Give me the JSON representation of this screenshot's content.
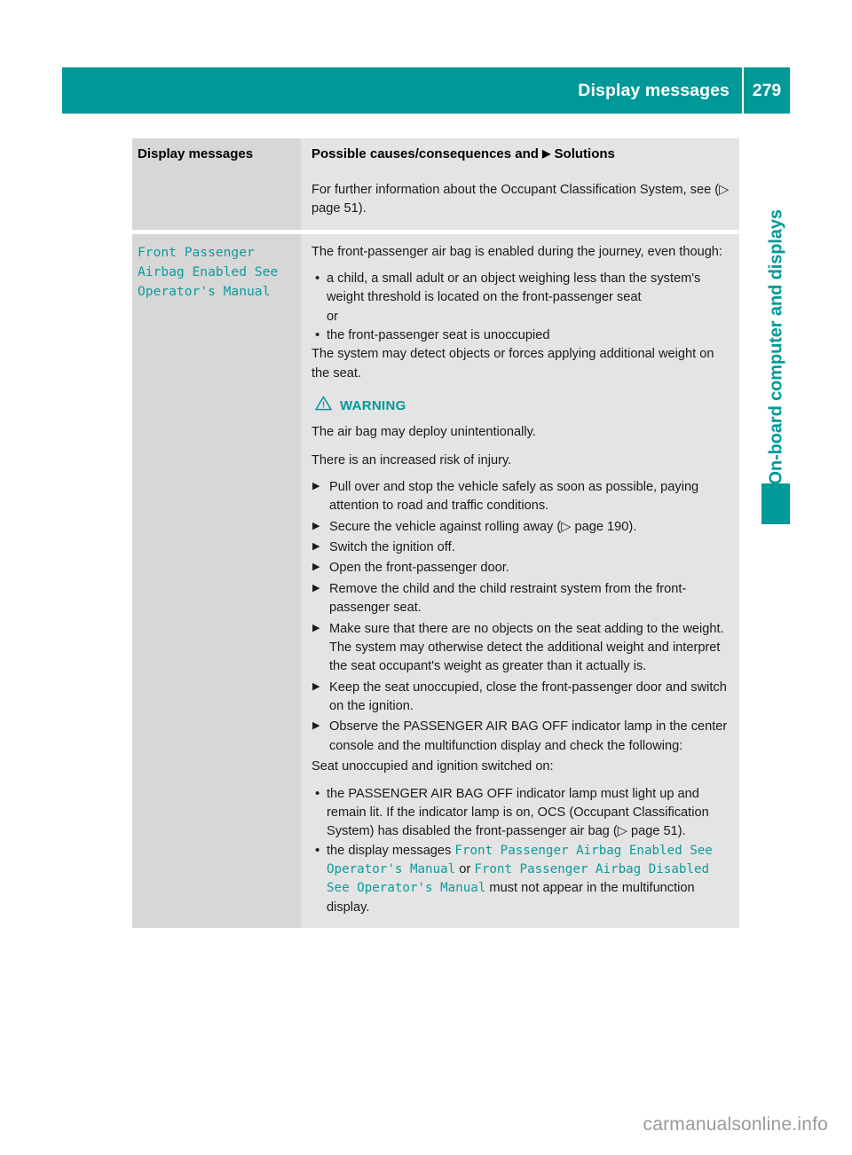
{
  "header": {
    "title": "Display messages",
    "page_number": "279",
    "accent_color": "#009898"
  },
  "sidebar": {
    "chapter_label": "On-board computer and displays"
  },
  "table": {
    "columns": {
      "left_header": "Display messages",
      "right_header_before": "Possible causes/consequences and",
      "right_header_marker": "▶",
      "right_header_after": "Solutions"
    },
    "rows": [
      {
        "message": "",
        "intro": "For further information about the Occupant Classification System, see (▷ page 51)."
      },
      {
        "message": "Front Passenger\nAirbag Enabled See\nOperator's Manual",
        "intro": "The front-passenger air bag is enabled during the journey, even though:",
        "bullets": [
          "a child, a small adult or an object weighing less than the system's weight threshold is located on the front-passenger seat",
          "or",
          "the front-passenger seat is unoccupied"
        ],
        "after_bullets": "The system may detect objects or forces applying additional weight on the seat.",
        "warning": {
          "icon": "warning-triangle-icon",
          "label": "WARNING",
          "lines": [
            "The air bag may deploy unintentionally.",
            "There is an increased risk of injury."
          ],
          "steps": [
            {
              "text": "Pull over and stop the vehicle safely as soon as possible, paying attention to road and traffic conditions."
            },
            {
              "text": "Secure the vehicle against rolling away (▷ page 190)."
            },
            {
              "text": "Switch the ignition off."
            },
            {
              "text": "Open the front-passenger door."
            },
            {
              "text": "Remove the child and the child restraint system from the front-passenger seat."
            },
            {
              "text": "Make sure that there are no objects on the seat adding to the weight.",
              "sub": "The system may otherwise detect the additional weight and interpret the seat occupant's weight as greater than it actually is."
            },
            {
              "text": "Keep the seat unoccupied, close the front-passenger door and switch on the ignition."
            },
            {
              "text": "Observe the PASSENGER AIR BAG OFF indicator lamp in the center console and the multifunction display and check the following:"
            }
          ],
          "condition": "Seat unoccupied and ignition switched on:",
          "checks": [
            {
              "text": "the PASSENGER AIR BAG OFF indicator lamp must light up and remain lit. If the indicator lamp is on, OCS (Occupant Classification System) has disabled the front-passenger air bag (▷ page 51)."
            },
            {
              "prefix": "the display messages ",
              "msg1": "Front Passenger Airbag Enabled See Operator's Manual",
              "mid": " or ",
              "msg2": "Front Passenger Airbag Disabled See Operator's Manual",
              "suffix": " must not appear in the multifunction display."
            }
          ]
        }
      }
    ]
  },
  "footer": {
    "watermark": "carmanualsonline.info"
  }
}
